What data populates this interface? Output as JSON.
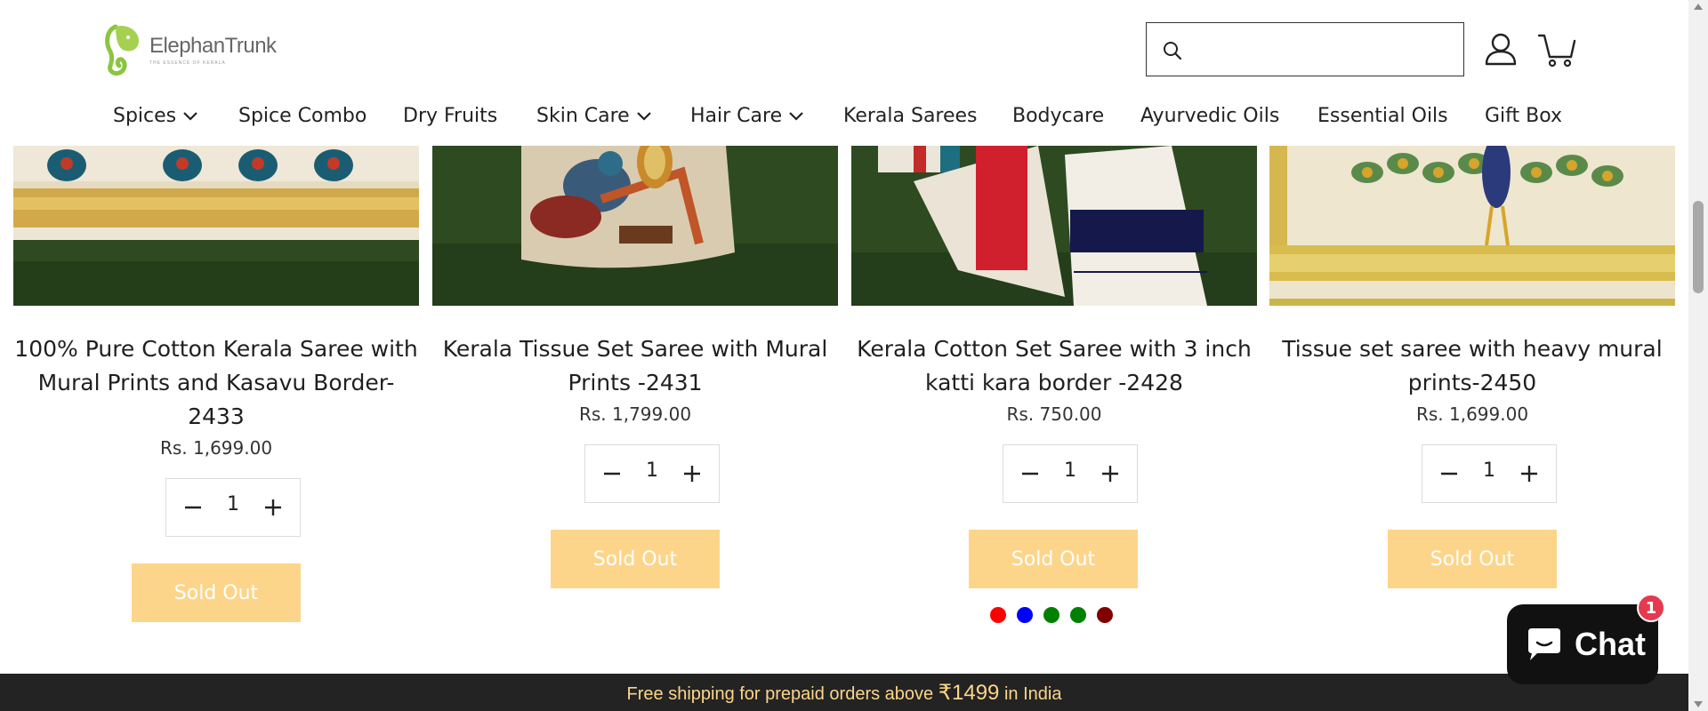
{
  "brand": {
    "name": "ElephanTrunk",
    "tagline": "THE ESSENCE OF KERALA",
    "accent": "#8bc53f"
  },
  "search": {
    "placeholder": ""
  },
  "nav": [
    {
      "label": "Spices",
      "dropdown": true
    },
    {
      "label": "Spice Combo",
      "dropdown": false
    },
    {
      "label": "Dry Fruits",
      "dropdown": false
    },
    {
      "label": "Skin Care",
      "dropdown": true
    },
    {
      "label": "Hair Care",
      "dropdown": true
    },
    {
      "label": "Kerala Sarees",
      "dropdown": false
    },
    {
      "label": "Bodycare",
      "dropdown": false
    },
    {
      "label": "Ayurvedic Oils",
      "dropdown": false
    },
    {
      "label": "Essential Oils",
      "dropdown": false
    },
    {
      "label": "Gift Box",
      "dropdown": false
    }
  ],
  "products": [
    {
      "title": "100% Pure Cotton Kerala Saree with Mural Prints and Kasavu Border-2433",
      "title_lines": [
        "100% Pure Cotton Kerala Saree with",
        "Mural Prints and Kasavu Border-",
        "2433"
      ],
      "price": "Rs. 1,699.00",
      "quantity": "1",
      "button": "Sold Out"
    },
    {
      "title": "Kerala Tissue Set Saree with Mural Prints -2431",
      "title_lines": [
        "Kerala Tissue Set Saree with Mural",
        "Prints -2431"
      ],
      "price": "Rs. 1,799.00",
      "quantity": "1",
      "button": "Sold Out"
    },
    {
      "title": "Kerala Cotton Set Saree with 3 inch katti kara border -2428",
      "title_lines": [
        "Kerala Cotton Set Saree with 3 inch",
        "katti kara border -2428"
      ],
      "price": "Rs. 750.00",
      "quantity": "1",
      "button": "Sold Out"
    },
    {
      "title": "Tissue set saree with heavy mural prints-2450",
      "title_lines": [
        "Tissue set saree with heavy mural",
        "prints-2450"
      ],
      "price": "Rs. 1,699.00",
      "quantity": "1",
      "button": "Sold Out"
    }
  ],
  "swatch_colors": [
    "#ff0000",
    "#0000ff",
    "#008000",
    "#008000",
    "#800000"
  ],
  "shipping_bar": {
    "text_before": "Free shipping for prepaid orders above ",
    "amount": "₹1499",
    "text_after": " in India"
  },
  "chat": {
    "label": "Chat",
    "badge": "1"
  },
  "colors": {
    "sold_out_bg": "#fdd58a",
    "bar_bg": "#232323",
    "bar_text": "#fdd58a",
    "chat_bg": "#111111",
    "badge_bg": "#e53950"
  }
}
